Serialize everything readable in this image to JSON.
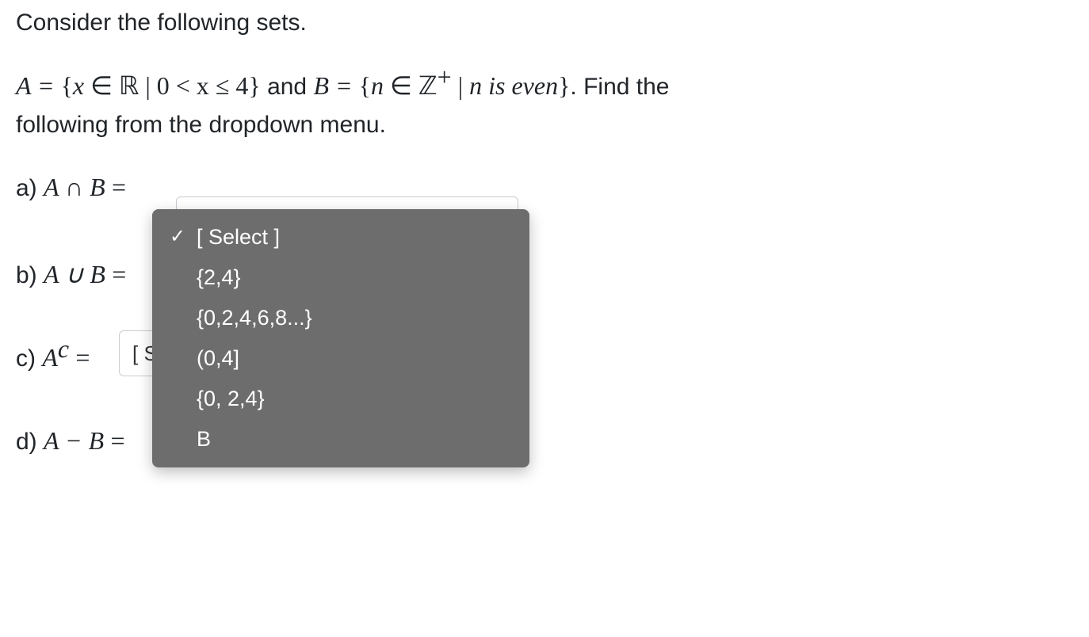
{
  "intro": "Consider the following sets.",
  "definition": {
    "A_eq": "A = ",
    "setA_open": "{",
    "x": "x",
    "in": " ∈ ",
    "R": "ℝ",
    "bar": " | ",
    "ineq": "0 < x ≤ 4",
    "setA_close": "}",
    "and": " and ",
    "B_eq": "B = ",
    "setB_open": "{",
    "n": "n",
    "Zplus": "ℤ",
    "plus": "+",
    "cond": "n is even",
    "setB_close": "}",
    "tail": ". Find the",
    "line2": "following from the dropdown menu."
  },
  "questions": {
    "a": {
      "label_prefix": "a) ",
      "expr": "A ∩ B",
      "eq": " ="
    },
    "b": {
      "label_prefix": "b) ",
      "expr": "A ∪ B",
      "eq": " ="
    },
    "c": {
      "label_prefix": "c) ",
      "expr_A": "A",
      "expr_sup": "c",
      "eq": " = ",
      "visible": "[ S"
    },
    "d": {
      "label_prefix": "d) ",
      "expr": "A − B",
      "eq": " ="
    }
  },
  "dropdown": {
    "selected_label": "[ Select ]",
    "options": [
      "{2,4}",
      "{0,2,4,6,8...}",
      "(0,4]",
      "{0, 2,4}",
      "B"
    ]
  },
  "select_placeholder": "[ Select ]"
}
